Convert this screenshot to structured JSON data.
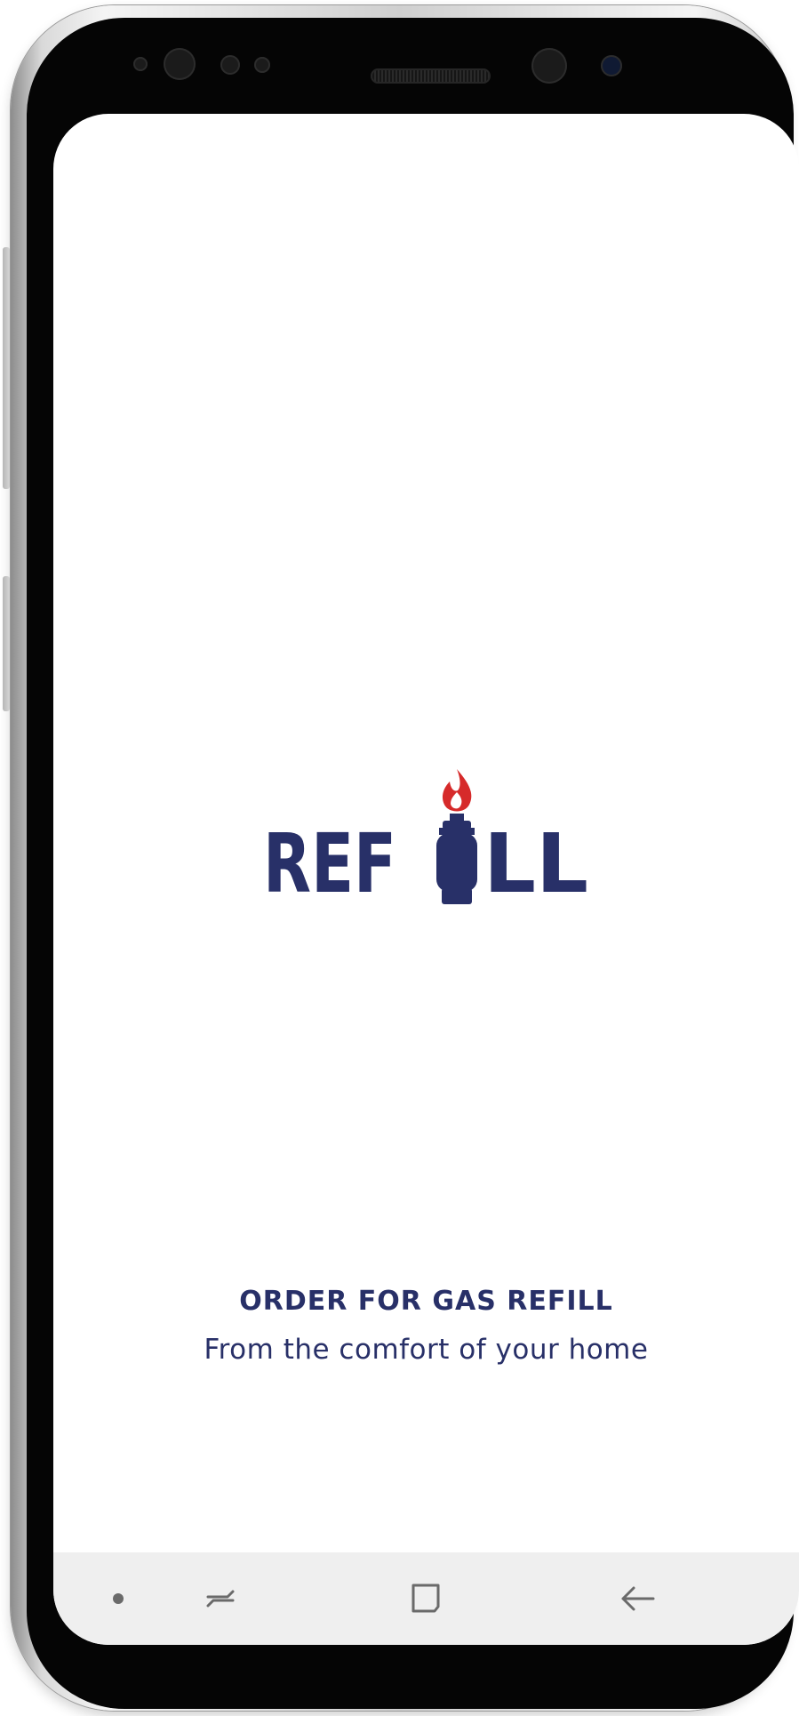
{
  "app": {
    "logo_text": "REFILL",
    "logo_letters": {
      "left": "REF",
      "right": "LL"
    }
  },
  "splash": {
    "heading": "ORDER FOR GAS REFILL",
    "subheading": "From the comfort of your home"
  },
  "nav_bar": {
    "items": [
      {
        "name": "dot",
        "icon": "dot-icon"
      },
      {
        "name": "recent-apps",
        "icon": "recent-apps-icon"
      },
      {
        "name": "home",
        "icon": "home-square-icon"
      },
      {
        "name": "back",
        "icon": "back-arrow-icon"
      }
    ]
  },
  "colors": {
    "brand_navy": "#283068",
    "flame_red": "#d62a2a",
    "nav_background": "#efefef",
    "nav_icon": "#6a6a6a",
    "screen_background": "#ffffff"
  }
}
